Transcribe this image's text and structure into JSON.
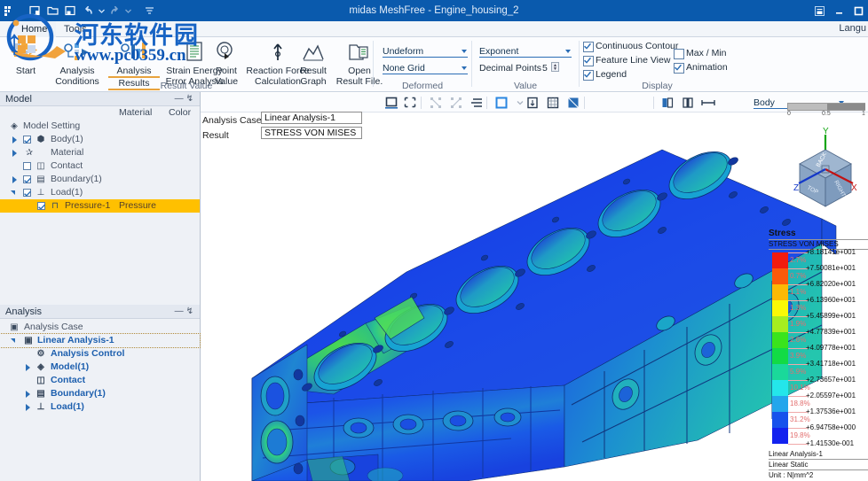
{
  "window": {
    "title": "midas MeshFree - Engine_housing_2",
    "buttons": {
      "restore": "▣",
      "minimize": "–",
      "maximize": "□"
    }
  },
  "quick_access": [
    {
      "name": "app-menu",
      "glyph": "⣿"
    },
    {
      "name": "new-file",
      "glyph": "◱"
    },
    {
      "name": "open-file",
      "glyph": "▭"
    },
    {
      "name": "save-file",
      "glyph": "◰"
    },
    {
      "name": "undo",
      "glyph": "↶"
    },
    {
      "name": "undo-dropdown",
      "glyph": "▾"
    },
    {
      "name": "redo",
      "glyph": "↷"
    },
    {
      "name": "redo-dropdown",
      "glyph": "▾"
    },
    {
      "name": "customize-qat",
      "glyph": "☰"
    }
  ],
  "ribbon": {
    "tabs": [
      {
        "label": "Home",
        "active": true
      },
      {
        "label": "Tools",
        "active": false
      }
    ],
    "language_label": "Langu",
    "groups": [
      {
        "label": "Result Value",
        "buttons": [
          {
            "label_l1": "Start",
            "label_l2": "",
            "selected": false
          },
          {
            "label_l1": "Analysis",
            "label_l2": "Conditions",
            "selected": false
          },
          {
            "label_l1": "Analysis",
            "label_l2": "Results",
            "selected": true
          },
          {
            "label_l1": "Strain Energy",
            "label_l2": "Error Analysis",
            "selected": false
          },
          {
            "label_l1": "Point",
            "label_l2": "Value",
            "selected": false
          },
          {
            "label_l1": "Reaction Force",
            "label_l2": "Calculation",
            "selected": false
          },
          {
            "label_l1": "Result",
            "label_l2": "Graph",
            "selected": false
          },
          {
            "label_l1": "Open",
            "label_l2": "Result File.",
            "selected": false
          }
        ]
      },
      {
        "label": "Deformed"
      },
      {
        "label": "Value"
      },
      {
        "label": "Display"
      }
    ],
    "deformed": {
      "deform_combo": "Undeform",
      "grid_combo": "None Grid"
    },
    "value": {
      "notation_combo": "Exponent",
      "decimal_label": "Decimal Points",
      "decimal_value": "5"
    },
    "display": {
      "continuous_contour": {
        "label": "Continuous Contour",
        "checked": true
      },
      "feature_line_view": {
        "label": "Feature Line View",
        "checked": true
      },
      "legend": {
        "label": "Legend",
        "checked": true
      },
      "max_min": {
        "label": "Max / Min",
        "checked": false
      },
      "animation": {
        "label": "Animation",
        "checked": true
      }
    }
  },
  "model_panel": {
    "title": "Model",
    "collapse_glyph": "—",
    "pin_glyph": "↯",
    "columns": {
      "material": "Material",
      "color": "Color"
    },
    "rows": [
      {
        "label": "Model Setting",
        "indent": 0,
        "expander": "none",
        "checkbox": "none",
        "icon": "model-setting-icon",
        "material": "",
        "selected": false
      },
      {
        "label": "Body(1)",
        "indent": 1,
        "expander": "collapsed",
        "checkbox": "checked",
        "icon": "body-icon",
        "material": "",
        "selected": false
      },
      {
        "label": "Material",
        "indent": 1,
        "expander": "collapsed",
        "checkbox": "none",
        "icon": "material-icon",
        "material": "",
        "selected": false
      },
      {
        "label": "Contact",
        "indent": 2,
        "expander": "none",
        "checkbox": "unchecked",
        "icon": "contact-icon",
        "material": "",
        "selected": false
      },
      {
        "label": "Boundary(1)",
        "indent": 1,
        "expander": "collapsed",
        "checkbox": "checked",
        "icon": "boundary-icon",
        "material": "",
        "selected": false
      },
      {
        "label": "Load(1)",
        "indent": 1,
        "expander": "expanded",
        "checkbox": "checked",
        "icon": "load-icon",
        "material": "",
        "selected": false
      },
      {
        "label": "Pressure-1",
        "indent": 3,
        "expander": "none",
        "checkbox": "checked",
        "icon": "pressure-icon",
        "material": "Pressure",
        "selected": true
      }
    ]
  },
  "analysis_panel": {
    "title": "Analysis",
    "collapse_glyph": "—",
    "pin_glyph": "↯",
    "rows": [
      {
        "label": "Analysis Case",
        "indent": 0,
        "expander": "none",
        "icon": "analysis-case-icon",
        "blue": false,
        "selected": false
      },
      {
        "label": "Linear Analysis-1",
        "indent": 1,
        "expander": "expanded",
        "icon": "analysis-case-icon",
        "blue": true,
        "selected": true
      },
      {
        "label": "Analysis Control",
        "indent": 3,
        "expander": "none",
        "icon": "analysis-control-icon",
        "blue": true,
        "selected": false
      },
      {
        "label": "Model(1)",
        "indent": 2,
        "expander": "collapsed",
        "icon": "model-setting-icon",
        "blue": true,
        "selected": false
      },
      {
        "label": "Contact",
        "indent": 3,
        "expander": "none",
        "icon": "contact-icon",
        "blue": true,
        "selected": false
      },
      {
        "label": "Boundary(1)",
        "indent": 2,
        "expander": "collapsed",
        "icon": "boundary-icon",
        "blue": true,
        "selected": false
      },
      {
        "label": "Load(1)",
        "indent": 2,
        "expander": "collapsed",
        "icon": "load-icon",
        "blue": true,
        "selected": false
      }
    ]
  },
  "view_toolbar": {
    "entity_combo": "Body",
    "buttons": [
      {
        "name": "select-rectangle-icon",
        "active": true,
        "enabled": true
      },
      {
        "name": "select-polygon-icon",
        "active": false,
        "enabled": true
      },
      {
        "name": "select-node-icon",
        "active": false,
        "enabled": false
      },
      {
        "name": "select-element-icon",
        "active": false,
        "enabled": false
      },
      {
        "name": "select-list-icon",
        "active": false,
        "enabled": true
      },
      {
        "name": "display-mode-icon",
        "active": true,
        "enabled": true
      },
      {
        "name": "front-view-icon",
        "active": false,
        "enabled": true
      },
      {
        "name": "iso-view-icon",
        "active": false,
        "enabled": true
      },
      {
        "name": "shaded-view-icon",
        "active": false,
        "enabled": true
      },
      {
        "name": "clip-plane-icon",
        "active": false,
        "enabled": true
      },
      {
        "name": "section-view-icon",
        "active": false,
        "enabled": true
      },
      {
        "name": "measure-distance-icon",
        "active": false,
        "enabled": true
      }
    ]
  },
  "canvas": {
    "analysis_case_label": "Analysis Case",
    "analysis_case_value": "Linear Analysis-1",
    "result_label": "Result",
    "result_value": "STRESS VON MISES",
    "animation_slider": {
      "min": "0",
      "mid": "0.5",
      "max": "1",
      "position_pct": 50
    },
    "view_cube": {
      "axis_x": "X",
      "axis_y": "Y",
      "axis_z": "Z",
      "face_top": "TOP",
      "face_back": "BACK",
      "face_right": "RIGHT"
    }
  },
  "legend": {
    "title": "Stress",
    "subtitle": "STRESS VON MISES",
    "footer": [
      "Linear Analysis-1",
      "Linear Static",
      "Unit : N|mm^2"
    ],
    "levels": [
      {
        "value": "+8.18141e+001",
        "color": "#f21b0d",
        "pct": "2.7%"
      },
      {
        "value": "+7.50081e+001",
        "color": "#fb5a09",
        "pct": "0.7%"
      },
      {
        "value": "+6.82020e+001",
        "color": "#fcb905",
        "pct": "1.1%"
      },
      {
        "value": "+6.13960e+001",
        "color": "#f9f906",
        "pct": "1.3%"
      },
      {
        "value": "+5.45899e+001",
        "color": "#a6ee20",
        "pct": "1.9%"
      },
      {
        "value": "+4.77839e+001",
        "color": "#3ae41c",
        "pct": "2.6%"
      },
      {
        "value": "+4.09778e+001",
        "color": "#12db45",
        "pct": "3.9%"
      },
      {
        "value": "+3.41718e+001",
        "color": "#1ad99a",
        "pct": "5.9%"
      },
      {
        "value": "+2.73657e+001",
        "color": "#24e6ea",
        "pct": "10.1%"
      },
      {
        "value": "+2.05597e+001",
        "color": "#23a6ec",
        "pct": "18.8%"
      },
      {
        "value": "+1.37536e+001",
        "color": "#1752ec",
        "pct": "31.2%"
      },
      {
        "value": "+6.94758e+000",
        "color": "#1322ef",
        "pct": "19.8%"
      },
      {
        "value": "+1.41530e-001",
        "color": "",
        "pct": ""
      }
    ]
  },
  "watermark": {
    "chinese": "河东软件园",
    "url": "www.pc0359.cn"
  },
  "chart_data": {
    "type": "heatmap",
    "title": "STRESS VON MISES",
    "unit": "N/mm^2",
    "contour_levels": [
      0.14153,
      6.94758,
      13.7536,
      20.5597,
      27.3657,
      34.1718,
      40.9778,
      47.7839,
      54.5899,
      61.396,
      68.202,
      75.0081,
      81.8141
    ],
    "band_percentages": [
      19.8,
      31.2,
      18.8,
      10.1,
      5.9,
      3.9,
      2.6,
      1.9,
      1.3,
      1.1,
      0.7,
      2.7
    ],
    "colors": [
      "#1322ef",
      "#1752ec",
      "#23a6ec",
      "#24e6ea",
      "#1ad99a",
      "#12db45",
      "#3ae41c",
      "#a6ee20",
      "#f9f906",
      "#fcb905",
      "#fb5a09",
      "#f21b0d"
    ],
    "ylim": [
      0.14153,
      81.8141
    ],
    "legend_position": "right"
  }
}
